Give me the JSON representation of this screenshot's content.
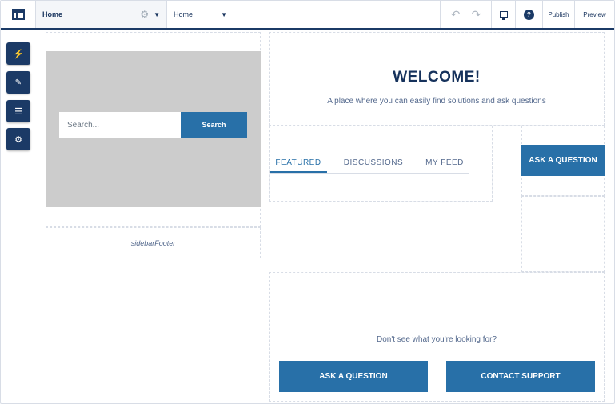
{
  "topbar": {
    "page_name": "Home",
    "view_name": "Home",
    "publish_label": "Publish",
    "preview_label": "Preview",
    "help_glyph": "?"
  },
  "tools": [
    {
      "icon": "lightning-icon",
      "glyph": "⚡"
    },
    {
      "icon": "brush-icon",
      "glyph": "🖌"
    },
    {
      "icon": "list-icon",
      "glyph": "☰"
    },
    {
      "icon": "gear-icon",
      "glyph": "⚙"
    }
  ],
  "hero": {
    "search_placeholder": "Search...",
    "search_button": "Search"
  },
  "sidebar_footer": "sidebarFooter",
  "main": {
    "title": "WELCOME!",
    "tagline": "A place where you can easily find solutions and ask questions",
    "tabs": [
      {
        "label": "FEATURED",
        "active": true
      },
      {
        "label": "DISCUSSIONS",
        "active": false
      },
      {
        "label": "MY FEED",
        "active": false
      }
    ],
    "ask_button": "ASK A QUESTION",
    "looking_text": "Don't see what you're looking for?",
    "ask_button_bottom": "ASK A QUESTION",
    "contact_button": "CONTACT SUPPORT"
  },
  "colors": {
    "brand_navy": "#1b3a66",
    "accent_blue": "#2870a8",
    "hero_gray": "#cccccc"
  }
}
